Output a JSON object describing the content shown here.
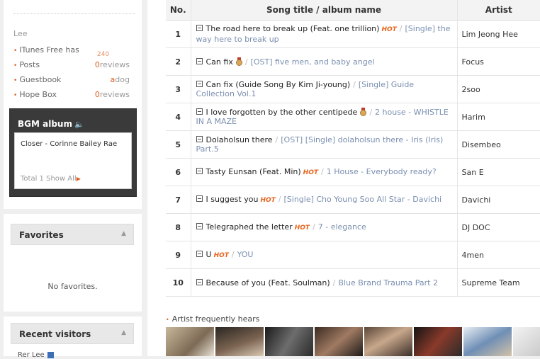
{
  "sidebar": {
    "user_name": "Lee",
    "menu": [
      {
        "label": "ITunes Free has",
        "count_num": "",
        "count_text": "",
        "faded": "240"
      },
      {
        "label": "Posts",
        "count_num": "0",
        "count_text": "reviews",
        "faded": ""
      },
      {
        "label": "Guestbook",
        "count_num": "a",
        "count_text": "dog",
        "faded": ""
      },
      {
        "label": "Hope Box",
        "count_num": "0",
        "count_text": "reviews",
        "faded": ""
      }
    ],
    "bgm": {
      "title": "BGM album",
      "song": "Closer - Corinne Bailey Rae",
      "footer_total": "Total 1",
      "footer_show": "Show All"
    },
    "favorites": {
      "title": "Favorites",
      "empty_text": "No favorites."
    },
    "recent": {
      "title": "Recent visitors",
      "first_visitor": "Rer Lee"
    }
  },
  "chart": {
    "headers": {
      "no": "No.",
      "title": "Song title / album name",
      "artist": "Artist"
    },
    "rows": [
      {
        "rank": "1",
        "song": "The road here to break up (Feat. one trillion)",
        "badge": "hot",
        "album": "[Single] the way here to break up",
        "artist": "Lim Jeong Hee"
      },
      {
        "rank": "2",
        "song": "Can fix",
        "badge": "medal",
        "album": "[OST] five men, and baby angel",
        "artist": "Focus"
      },
      {
        "rank": "3",
        "song": "Can fix (Guide Song By Kim Ji-young)",
        "badge": "",
        "album": "[Single] Guide Collection Vol.1",
        "artist": "2soo"
      },
      {
        "rank": "4",
        "song": "I love forgotten by the other centipede",
        "badge": "medal",
        "album": "2 house - WHISTLE IN A MAZE",
        "artist": "Harim"
      },
      {
        "rank": "5",
        "song": "Dolaholsun there",
        "badge": "",
        "album": "[OST] [Single] dolaholsun there - Iris (Iris) Part.5",
        "artist": "Disembeo"
      },
      {
        "rank": "6",
        "song": "Tasty Eunsan (Feat. Min)",
        "badge": "hot",
        "album": "1 House - Everybody ready?",
        "artist": "San E"
      },
      {
        "rank": "7",
        "song": "I suggest you",
        "badge": "hot",
        "album": "[Single] Cho Young Soo All Star - Davichi",
        "artist": "Davichi"
      },
      {
        "rank": "8",
        "song": "Telegraphed the letter",
        "badge": "hot",
        "album": "7 - elegance",
        "artist": "DJ DOC"
      },
      {
        "rank": "9",
        "song": "U",
        "badge": "hot",
        "album": "YOU",
        "artist": "4men"
      },
      {
        "rank": "10",
        "song": "Because of you (Feat. Soulman)",
        "badge": "",
        "album": "Blue Brand Trauma Part 2",
        "artist": "Supreme Team"
      }
    ],
    "hot_label": "HOT"
  },
  "frequent": {
    "label": "Artist frequently hears",
    "thumbs": [
      "artist-photo-1",
      "artist-photo-2",
      "artist-photo-3",
      "artist-photo-4",
      "artist-photo-5",
      "artist-photo-6",
      "artist-photo-7",
      "artist-photo-8"
    ]
  },
  "colors": {
    "accent": "#e06020",
    "album_link": "#7a8fb0",
    "bgm_box": "#3a3a3a"
  }
}
